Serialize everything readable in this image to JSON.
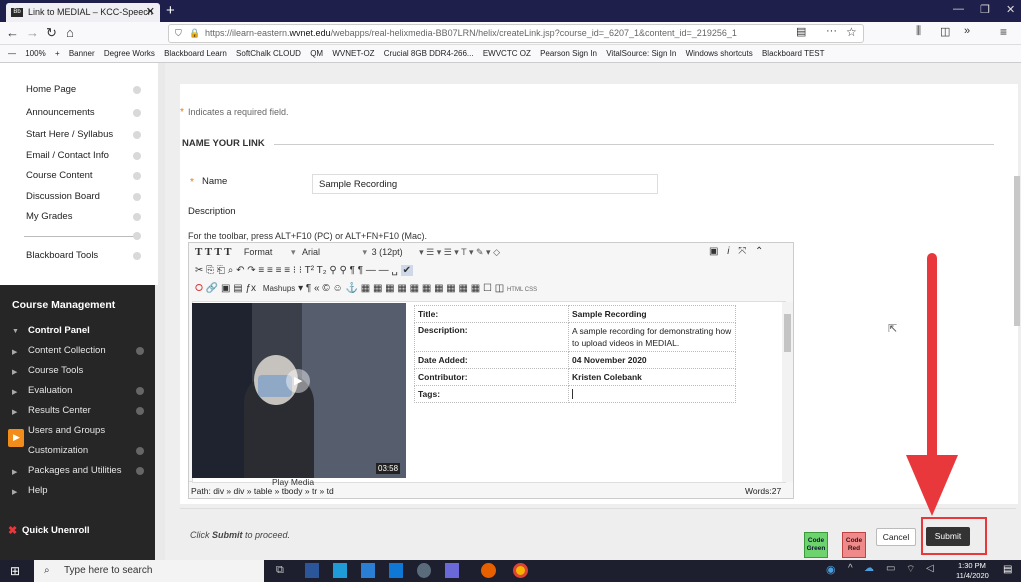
{
  "browser": {
    "tab_title": "Link to MEDIAL – KCC-Speech",
    "favicon_text": "Bb",
    "url_prefix": "https://ilearn-eastern.",
    "url_domain": "wvnet.edu",
    "url_rest": "/webapps/real-helixmedia-BB07LRN/helix/createLink.jsp?course_id=_6207_1&content_id=_219256_1",
    "zoom": "100%",
    "bookmarks": [
      "Banner",
      "Degree Works",
      "Blackboard Learn",
      "SoftChalk CLOUD",
      "QM",
      "WVNET-OZ",
      "Crucial 8GB DDR4-266...",
      "EWVCTC OZ",
      "Pearson Sign In",
      "VitalSource: Sign In",
      "Windows shortcuts",
      "Blackboard TEST"
    ]
  },
  "sidebar": {
    "items": [
      "Home Page",
      "Announcements",
      "Start Here / Syllabus",
      "Email / Contact Info",
      "Course Content",
      "Discussion Board",
      "My Grades",
      "Blackboard Tools"
    ],
    "course_management": "Course Management",
    "control_panel": "Control Panel",
    "cp_items": [
      "Content Collection",
      "Course Tools",
      "Evaluation",
      "Results Center",
      "Users and Groups",
      "Customization",
      "Packages and Utilities",
      "Help"
    ],
    "quick_unenroll": "Quick Unenroll"
  },
  "form": {
    "required_note": "Indicates a required field.",
    "section_title": "NAME YOUR LINK",
    "name_label": "Name",
    "name_value": "Sample Recording",
    "description_label": "Description",
    "toolbar_hint": "For the toolbar, press ALT+F10 (PC) or ALT+FN+F10 (Mac).",
    "format_label": "Format",
    "font_label": "Arial",
    "size_label": "3 (12pt)",
    "mashups_label": "Mashups",
    "html_label": "HTML CSS",
    "path": "Path: div » div » table » tbody » tr » td",
    "words": "Words:27"
  },
  "media": {
    "duration": "03:58",
    "play_text": "Play Media",
    "rows": [
      {
        "label": "Title:",
        "value": "Sample Recording"
      },
      {
        "label": "Description:",
        "value": "A sample recording for demonstrating how to upload videos in MEDIAL."
      },
      {
        "label": "Date Added:",
        "value": "04 November 2020"
      },
      {
        "label": "Contributor:",
        "value": "Kristen Colebank"
      },
      {
        "label": "Tags:",
        "value": ""
      }
    ]
  },
  "footer": {
    "proceed_text_pre": "Click ",
    "proceed_text_bold": "Submit",
    "proceed_text_post": " to proceed.",
    "code_green": "Code Green",
    "code_red": "Code Red",
    "cancel": "Cancel",
    "submit": "Submit"
  },
  "taskbar": {
    "search_placeholder": "Type here to search",
    "time": "1:30 PM",
    "date": "11/4/2020"
  },
  "colors": {
    "annotation_red": "#e8383b",
    "code_green": "#6dd46d",
    "code_red": "#f08a8a",
    "sidebar_dark": "#262626"
  }
}
